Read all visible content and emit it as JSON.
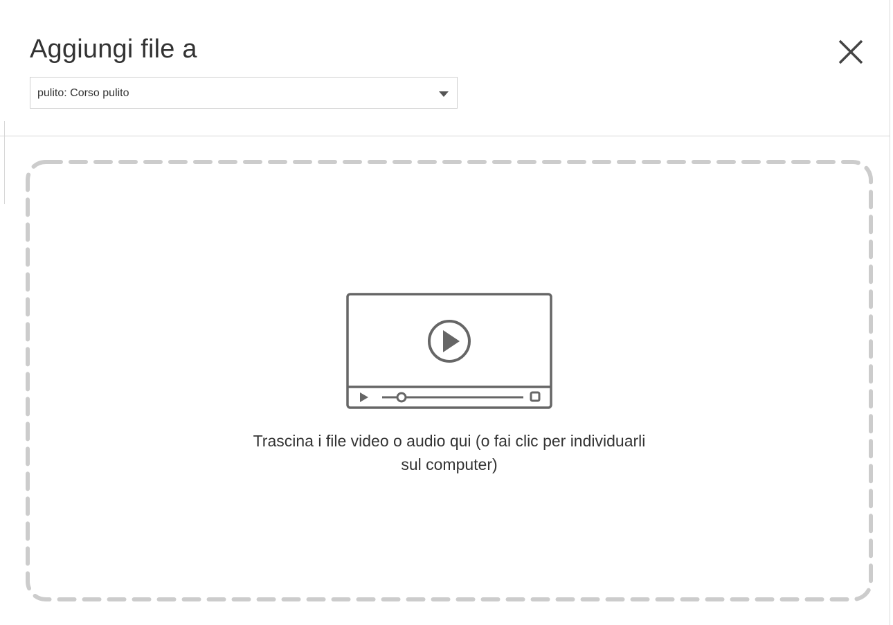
{
  "dialog": {
    "title": "Aggiungi file a",
    "close_icon": "close-icon"
  },
  "destination_select": {
    "value": "pulito: Corso pulito",
    "arrow_icon": "caret-down-icon"
  },
  "dropzone": {
    "icon": "video-player-icon",
    "text": "Trascina i file video o audio qui (o fai clic per individuarli sul computer)"
  },
  "colors": {
    "text": "#333333",
    "dash_border": "#cccccc",
    "icon": "#666666",
    "divider": "#d6d6d6"
  }
}
